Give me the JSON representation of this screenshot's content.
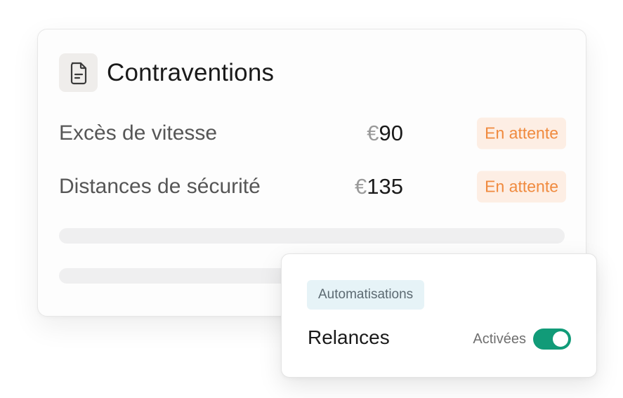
{
  "card": {
    "title": "Contraventions",
    "icon": "document-icon"
  },
  "fines": [
    {
      "label": "Excès de vitesse",
      "currency": "€",
      "amount": "90",
      "status": "En attente"
    },
    {
      "label": "Distances de sécurité",
      "currency": "€",
      "amount": "135",
      "status": "En attente"
    }
  ],
  "automation": {
    "tag": "Automatisations",
    "setting_label": "Relances",
    "toggle_state_label": "Activées",
    "toggle_on": true
  },
  "colors": {
    "status_text": "#f08a3e",
    "status_bg": "#fdeee4",
    "toggle_on": "#119b78",
    "tag_bg": "#e6f3f7"
  }
}
